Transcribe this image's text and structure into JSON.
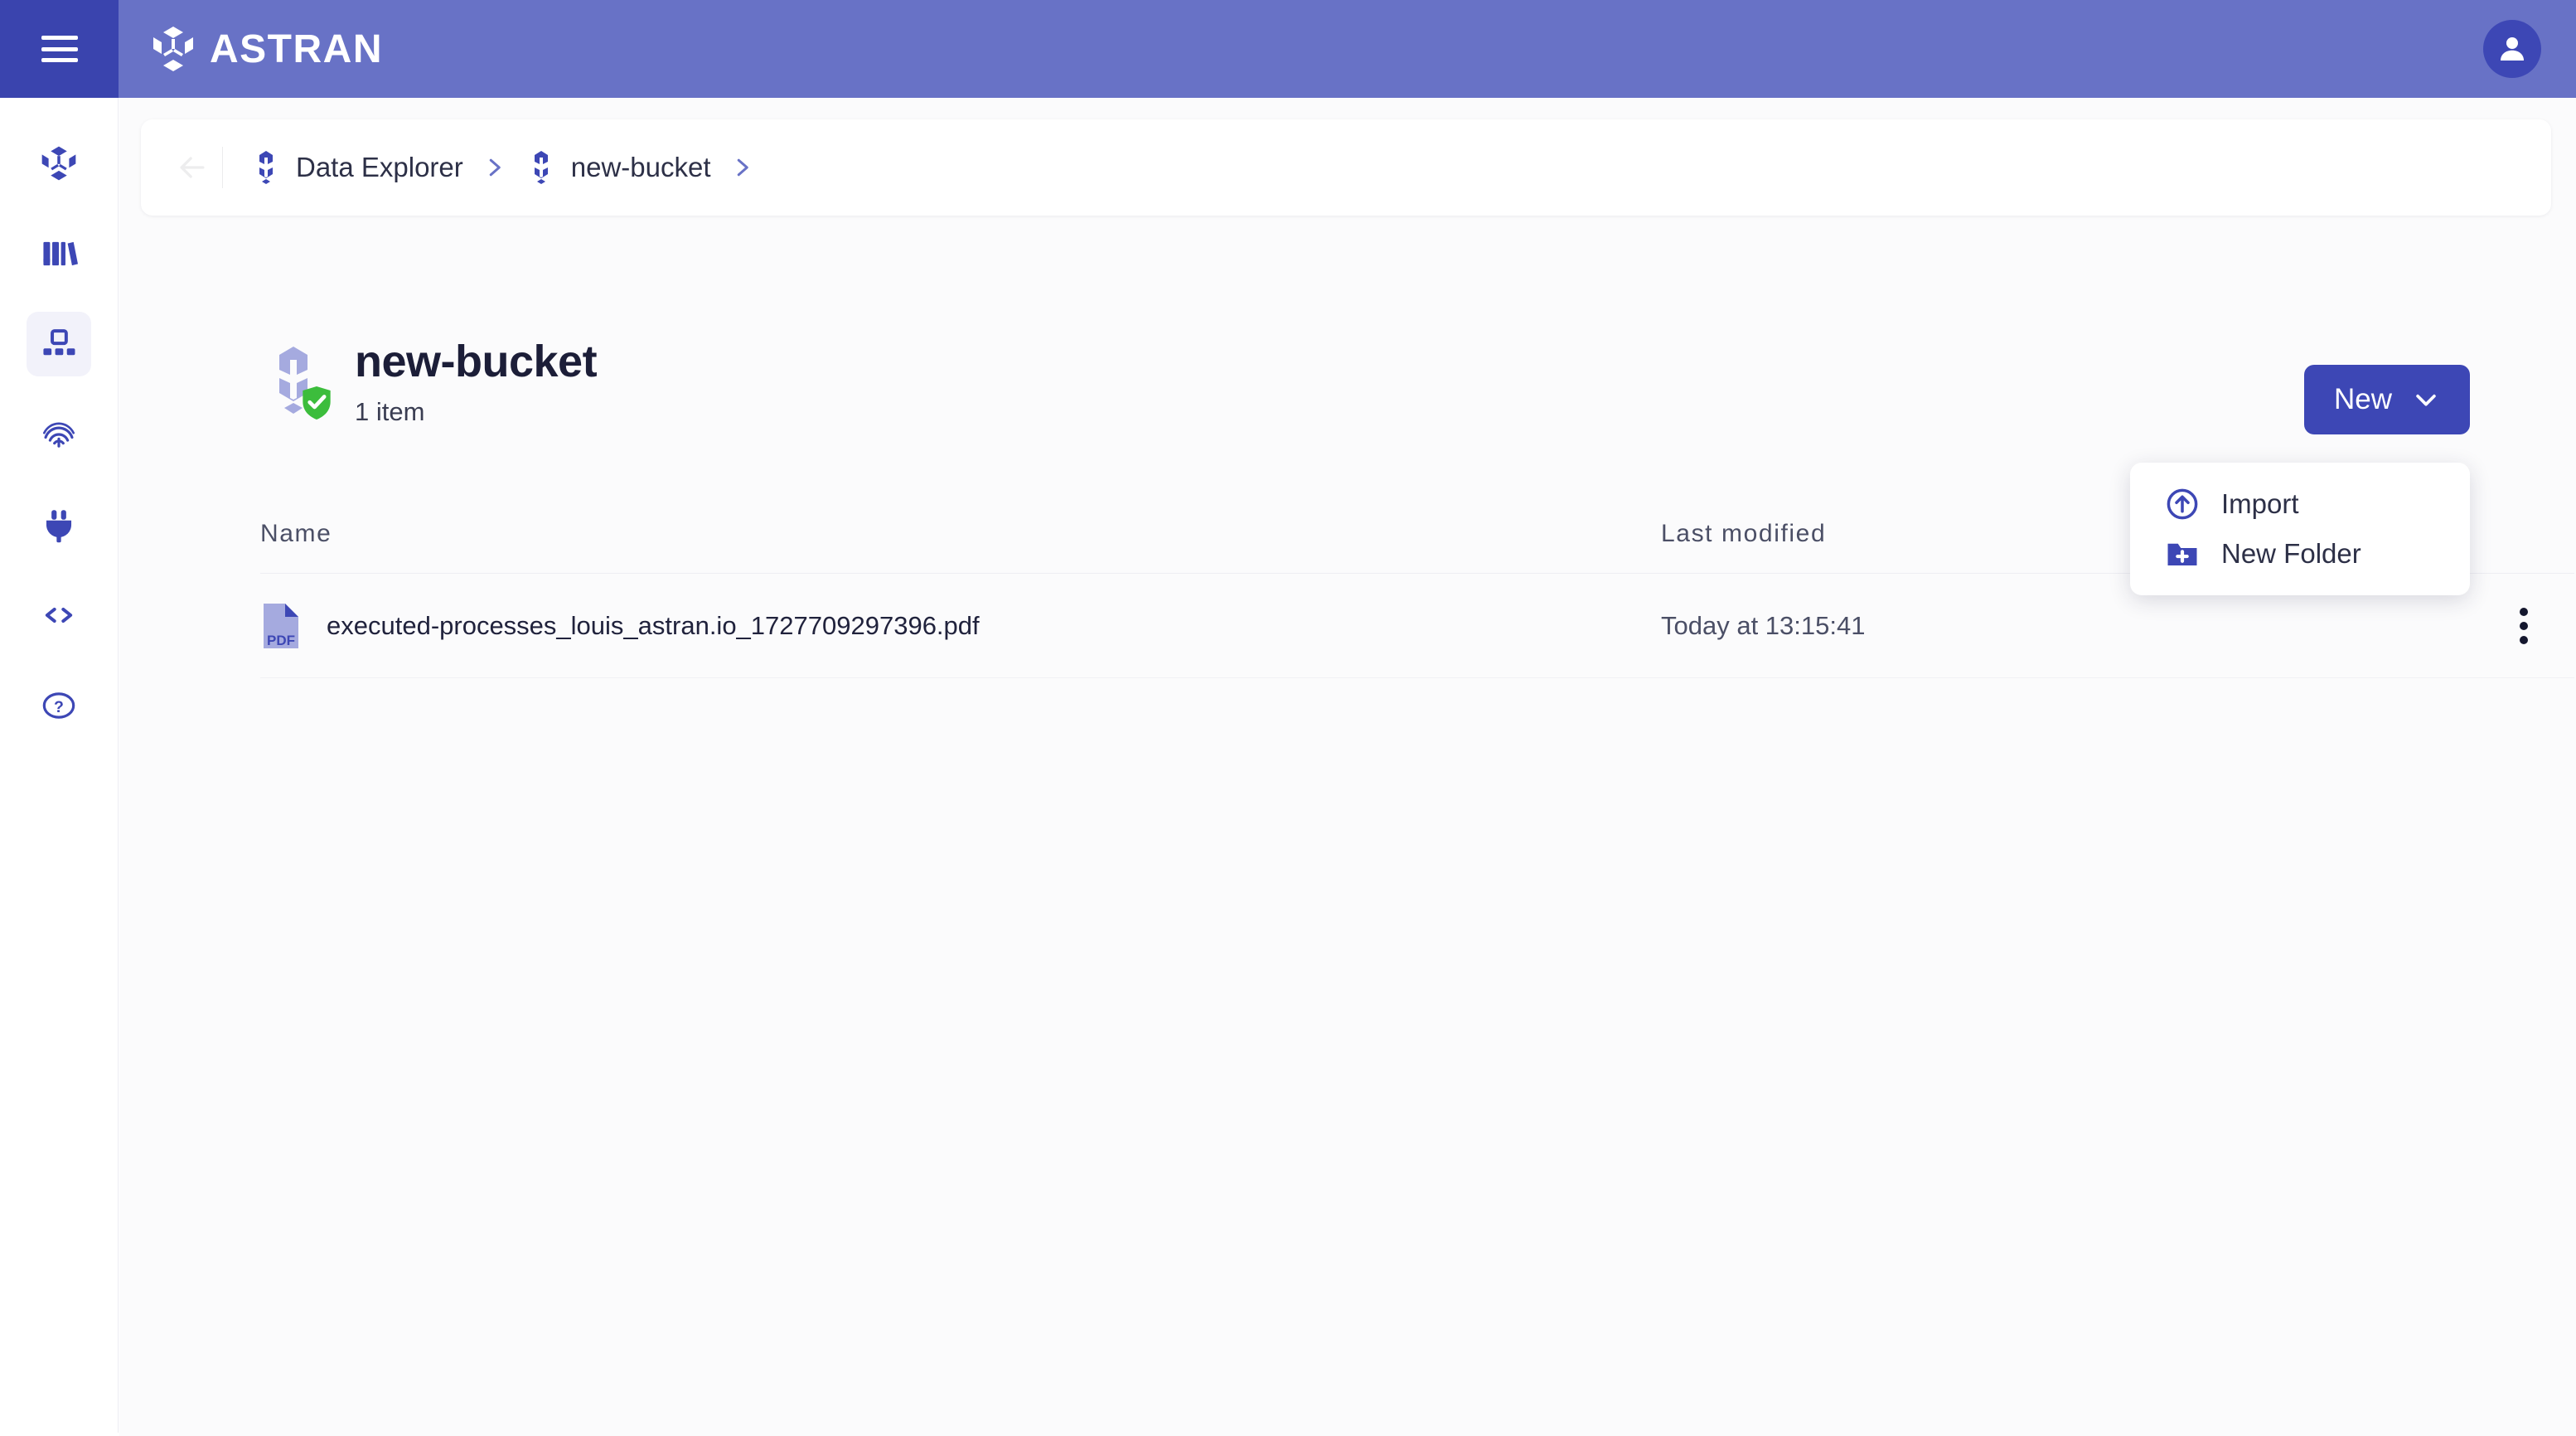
{
  "header": {
    "brand": "ASTRAN",
    "menu_icon": "hamburger-icon",
    "logo_icon": "astran-hexagon-logo",
    "avatar_icon": "user-avatar-icon"
  },
  "sidebar": {
    "items": [
      {
        "icon": "astran-hexagon-icon",
        "name": "home",
        "active": false
      },
      {
        "icon": "books-library-icon",
        "name": "library",
        "active": false
      },
      {
        "icon": "data-explorer-icon",
        "name": "data-explorer",
        "active": true
      },
      {
        "icon": "fingerprint-icon",
        "name": "identity",
        "active": false
      },
      {
        "icon": "plug-connector-icon",
        "name": "connectors",
        "active": false
      },
      {
        "icon": "code-brackets-icon",
        "name": "developers",
        "active": false
      },
      {
        "icon": "help-circle-icon",
        "name": "help",
        "active": false
      }
    ]
  },
  "breadcrumb": {
    "back_icon": "arrow-left-icon",
    "items": [
      {
        "label": "Data Explorer",
        "icon": "hexagon-icon"
      },
      {
        "label": "new-bucket",
        "icon": "hexagon-icon"
      }
    ]
  },
  "page": {
    "title": "new-bucket",
    "subtitle": "1 item",
    "bucket_icon": "hexagon-bucket-icon",
    "badge_icon": "shield-check-icon"
  },
  "toolbar": {
    "new_label": "New",
    "new_chevron_icon": "chevron-down-icon"
  },
  "dropdown": {
    "items": [
      {
        "label": "Import",
        "icon": "circle-arrow-up-icon"
      },
      {
        "label": "New Folder",
        "icon": "folder-plus-icon"
      }
    ]
  },
  "table": {
    "columns": [
      "Name",
      "Last modified"
    ],
    "rows": [
      {
        "name": "executed-processes_louis_astran.io_1727709297396.pdf",
        "icon": "pdf-file-icon",
        "modified": "Today at 13:15:41",
        "actions_icon": "more-vertical-icon"
      }
    ]
  },
  "colors": {
    "header_bg": "#6872c6",
    "menu_bg": "#3a44ae",
    "accent": "#3d47b5",
    "badge_green": "#3cbd3c",
    "icon_light_purple": "#a5aadf",
    "active_item_bg": "#f2f2fa"
  }
}
